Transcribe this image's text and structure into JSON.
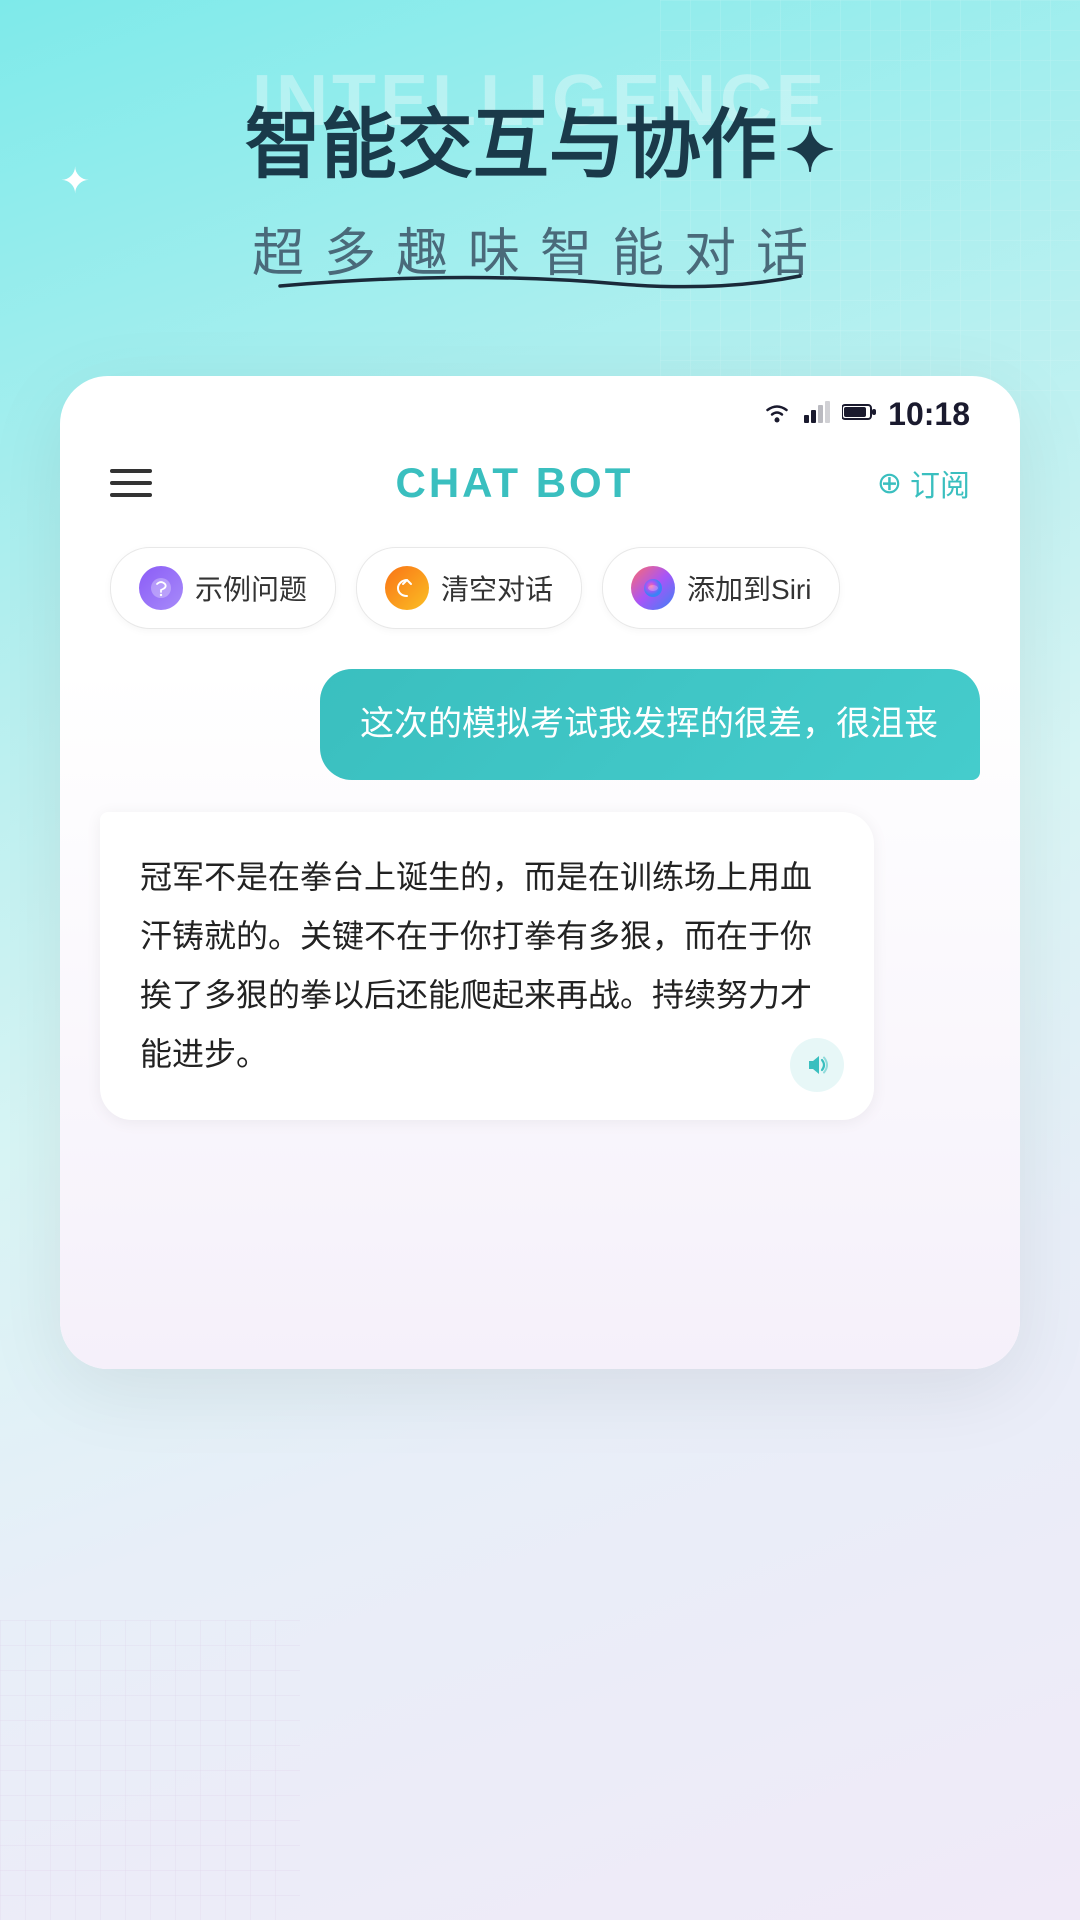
{
  "background": {
    "hero_bg_text": "INTELLIGENCE"
  },
  "hero": {
    "title": "智能交互与协作",
    "star": "✦",
    "sparkle": "✦",
    "subtitle": "超多趣味智能对话"
  },
  "status_bar": {
    "time": "10:18"
  },
  "header": {
    "title": "CHAT BOT",
    "subscribe_label": "订阅",
    "subscribe_icon": "⊕"
  },
  "quick_actions": [
    {
      "id": "example",
      "icon": "🔮",
      "icon_class": "chip-icon-purple",
      "label": "示例问题"
    },
    {
      "id": "clear",
      "icon": "♻",
      "icon_class": "chip-icon-orange",
      "label": "清空对话"
    },
    {
      "id": "siri",
      "icon": "◉",
      "icon_class": "chip-icon-siri",
      "label": "添加到Siri"
    }
  ],
  "chat": {
    "user_message": "这次的模拟考试我发挥的很差，很沮丧",
    "bot_message": "冠军不是在拳台上诞生的，而是在训练场上用血汗铸就的。关键不在于你打拳有多狠，而在于你挨了多狠的拳以后还能爬起来再战。持续努力才能进步。",
    "speaker_icon": "🔊"
  }
}
